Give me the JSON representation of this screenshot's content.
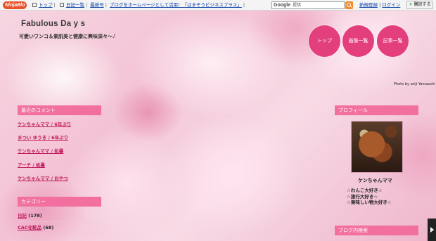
{
  "topbar": {
    "logo": "NinjaBlo",
    "nav": [
      {
        "label": "トップ",
        "sep": "|"
      },
      {
        "label": "日記一覧",
        "sep": "|"
      },
      {
        "label": "最新号",
        "sep": "|"
      },
      {
        "label": "ブログをホームページとして活用！「はまぞうビジネスプラス」",
        "sep": "|"
      }
    ],
    "search_brand": "Google",
    "search_placeholder": "提供",
    "register": "新規登録",
    "login": "ログイン",
    "subscribe_plus": "+",
    "subscribe": "購読する"
  },
  "header": {
    "title": "Fabulous Da y s",
    "description": "可愛いワンコ＆素肌美と健康に興味深々～♪",
    "nav": [
      "トップ",
      "画像一覧",
      "記事一覧"
    ],
    "credit": "Photo by seiji Yamauchi"
  },
  "recent_comments": {
    "heading": "最近のコメント",
    "items": [
      {
        "text": "ケンちゃんママ / 6年ぶり"
      },
      {
        "text": "まつい ゆうき / 6年ぶり"
      },
      {
        "text": "ケンちゃんママ / 処暑"
      },
      {
        "text": "アーチ / 処暑"
      },
      {
        "text": "ケンちゃんママ / おやつ"
      }
    ]
  },
  "categories": {
    "heading": "カテゴリー",
    "items": [
      {
        "name": "日記",
        "count": "(178)"
      },
      {
        "name": "CAC化粧品",
        "count": "(68)"
      }
    ]
  },
  "profile": {
    "heading": "プロフィール",
    "name": "ケンちゃんママ",
    "lines": [
      "☆わんこ大好き☆",
      "☆旅行大好き☆",
      "☆美味しい物大好き☆"
    ]
  },
  "blog_search": {
    "heading": "ブログ内検索"
  },
  "colors": {
    "accent": "#f1709f",
    "nav_circle": "#e43f7d",
    "link": "#c0185a"
  }
}
